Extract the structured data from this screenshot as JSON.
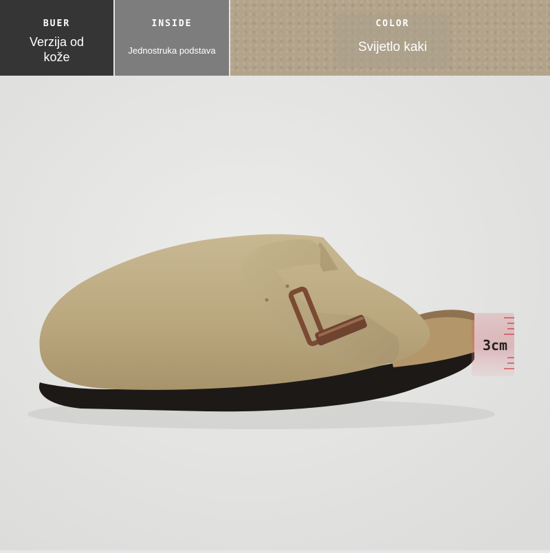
{
  "specs": [
    {
      "key": "BUER",
      "value": "Verzija od kože"
    },
    {
      "key": "INSIDE",
      "value": "Jednostruka podstava"
    },
    {
      "key": "COLOR",
      "value": "Svijetlo kaki"
    }
  ],
  "height_marker": {
    "label": "3cm"
  },
  "colors": {
    "suede": "#bfae87",
    "sole": "#1a1614",
    "cork": "#b4966b",
    "buckle": "#7a4a33",
    "marker": "#c9343f"
  }
}
